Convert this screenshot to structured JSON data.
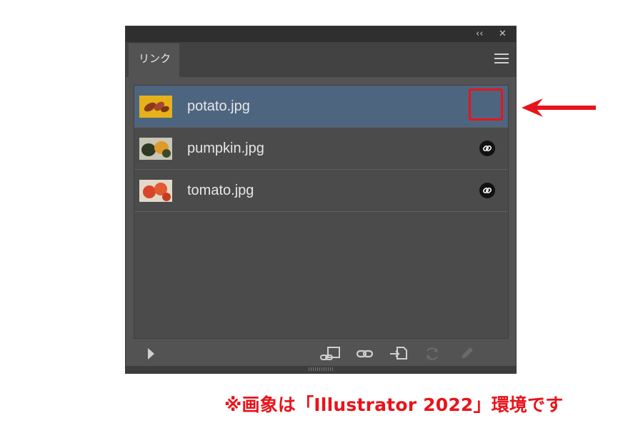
{
  "window": {
    "collapse_glyph": "‹‹",
    "close_glyph": "✕",
    "tab_label": "リンク"
  },
  "links": [
    {
      "filename": "potato.jpg",
      "selected": true,
      "status_icon": "none",
      "thumb": "potato-thumbnail"
    },
    {
      "filename": "pumpkin.jpg",
      "selected": false,
      "status_icon": "embedded-link-icon",
      "thumb": "pumpkin-thumbnail"
    },
    {
      "filename": "tomato.jpg",
      "selected": false,
      "status_icon": "embedded-link-icon",
      "thumb": "tomato-thumbnail"
    }
  ],
  "toolbar": {
    "icons": [
      "expand-triangle-icon",
      "relink-from-libraries-icon",
      "relink-icon",
      "go-to-link-icon",
      "update-link-icon",
      "edit-original-icon"
    ]
  },
  "annotation": {
    "note": "※画象は「Illustrator 2022」環境です",
    "color": "#e8141b"
  },
  "colors": {
    "panel_bg": "#535353",
    "selected_row": "#4e6580",
    "highlight": "#e8141b"
  }
}
